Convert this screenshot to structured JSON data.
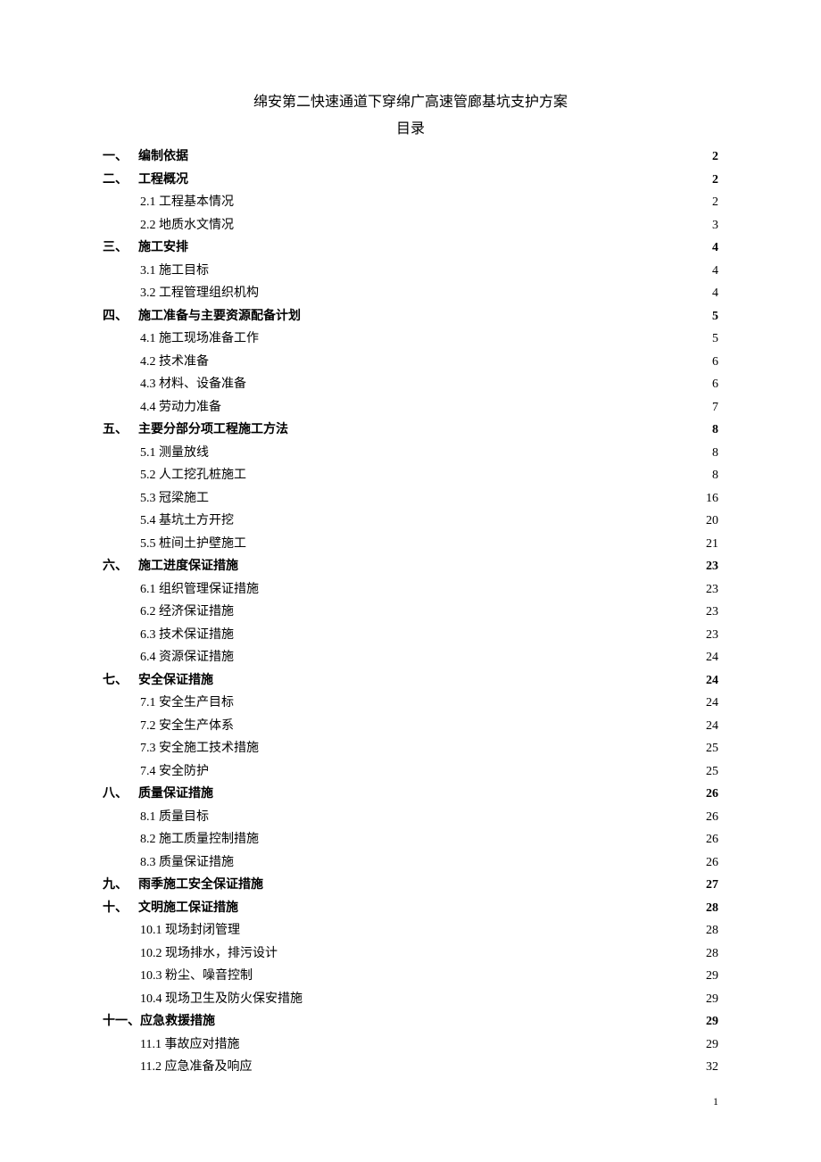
{
  "doc_title": "绵安第二快速通道下穿绵广高速管廊基坑支护方案",
  "toc_label": "目录",
  "page_number": "1",
  "toc": [
    {
      "level": 1,
      "prefix": "一、",
      "text": "编制依据",
      "page": "2"
    },
    {
      "level": 1,
      "prefix": "二、",
      "text": " 工程概况",
      "page": "2"
    },
    {
      "level": 2,
      "prefix": "",
      "text": "2.1 工程基本情况",
      "page": "2"
    },
    {
      "level": 2,
      "prefix": "",
      "text": "2.2 地质水文情况",
      "page": "3"
    },
    {
      "level": 1,
      "prefix": "三、",
      "text": "施工安排",
      "page": "4"
    },
    {
      "level": 2,
      "prefix": "",
      "text": "3.1  施工目标",
      "page": "4"
    },
    {
      "level": 2,
      "prefix": "",
      "text": "3.2  工程管理组织机构",
      "page": "4"
    },
    {
      "level": 1,
      "prefix": "四、",
      "text": "施工准备与主要资源配备计划",
      "page": "5"
    },
    {
      "level": 2,
      "prefix": "",
      "text": "4.1 施工现场准备工作",
      "page": "5"
    },
    {
      "level": 2,
      "prefix": "",
      "text": "4.2 技术准备",
      "page": "6"
    },
    {
      "level": 2,
      "prefix": "",
      "text": "4.3 材料、设备准备",
      "page": "6"
    },
    {
      "level": 2,
      "prefix": "",
      "text": "4.4 劳动力准备",
      "page": "7"
    },
    {
      "level": 1,
      "prefix": "五、",
      "text": "主要分部分项工程施工方法",
      "page": "8"
    },
    {
      "level": 2,
      "prefix": "",
      "text": "5.1 测量放线",
      "page": "8"
    },
    {
      "level": 2,
      "prefix": "",
      "text": "5.2 人工挖孔桩施工",
      "page": "8"
    },
    {
      "level": 2,
      "prefix": "",
      "text": "5.3 冠梁施工",
      "page": "16"
    },
    {
      "level": 2,
      "prefix": "",
      "text": "5.4  基坑土方开挖",
      "page": "20"
    },
    {
      "level": 2,
      "prefix": "",
      "text": "5.5 桩间土护壁施工",
      "page": "21"
    },
    {
      "level": 1,
      "prefix": "六、",
      "text": "施工进度保证措施",
      "page": "23"
    },
    {
      "level": 2,
      "prefix": "",
      "text": "6.1 组织管理保证措施",
      "page": "23"
    },
    {
      "level": 2,
      "prefix": "",
      "text": "6.2 经济保证措施",
      "page": "23"
    },
    {
      "level": 2,
      "prefix": "",
      "text": "6.3 技术保证措施",
      "page": "23"
    },
    {
      "level": 2,
      "prefix": "",
      "text": "6.4 资源保证措施",
      "page": "24"
    },
    {
      "level": 1,
      "prefix": "七、",
      "text": "安全保证措施",
      "page": "24"
    },
    {
      "level": 2,
      "prefix": "",
      "text": "7.1 安全生产目标",
      "page": "24"
    },
    {
      "level": 2,
      "prefix": "",
      "text": "7.2 安全生产体系",
      "page": "24"
    },
    {
      "level": 2,
      "prefix": "",
      "text": "7.3 安全施工技术措施",
      "page": "25"
    },
    {
      "level": 2,
      "prefix": "",
      "text": "7.4 安全防护",
      "page": "25"
    },
    {
      "level": 1,
      "prefix": "八、",
      "text": "质量保证措施",
      "page": "26"
    },
    {
      "level": 2,
      "prefix": "",
      "text": "8.1 质量目标",
      "page": "26"
    },
    {
      "level": 2,
      "prefix": "",
      "text": "8.2 施工质量控制措施",
      "page": "26"
    },
    {
      "level": 2,
      "prefix": "",
      "text": "8.3 质量保证措施",
      "page": "26"
    },
    {
      "level": 1,
      "prefix": "九、",
      "text": "雨季施工安全保证措施",
      "page": "27"
    },
    {
      "level": 1,
      "prefix": "十、",
      "text": " 文明施工保证措施",
      "page": "28"
    },
    {
      "level": 2,
      "prefix": "",
      "text": "10.1 现场封闭管理",
      "page": "28"
    },
    {
      "level": 2,
      "prefix": "",
      "text": "10.2 现场排水，排污设计",
      "page": "28"
    },
    {
      "level": 2,
      "prefix": "",
      "text": "10.3 粉尘、噪音控制",
      "page": "29"
    },
    {
      "level": 2,
      "prefix": "",
      "text": "10.4 现场卫生及防火保安措施",
      "page": "29"
    },
    {
      "level": 1,
      "prefix": "十一、",
      "text": "应急救援措施",
      "page": "29"
    },
    {
      "level": 2,
      "prefix": "",
      "text": "11.1 事故应对措施",
      "page": "29"
    },
    {
      "level": 2,
      "prefix": "",
      "text": "11.2 应急准备及响应",
      "page": "32"
    }
  ]
}
